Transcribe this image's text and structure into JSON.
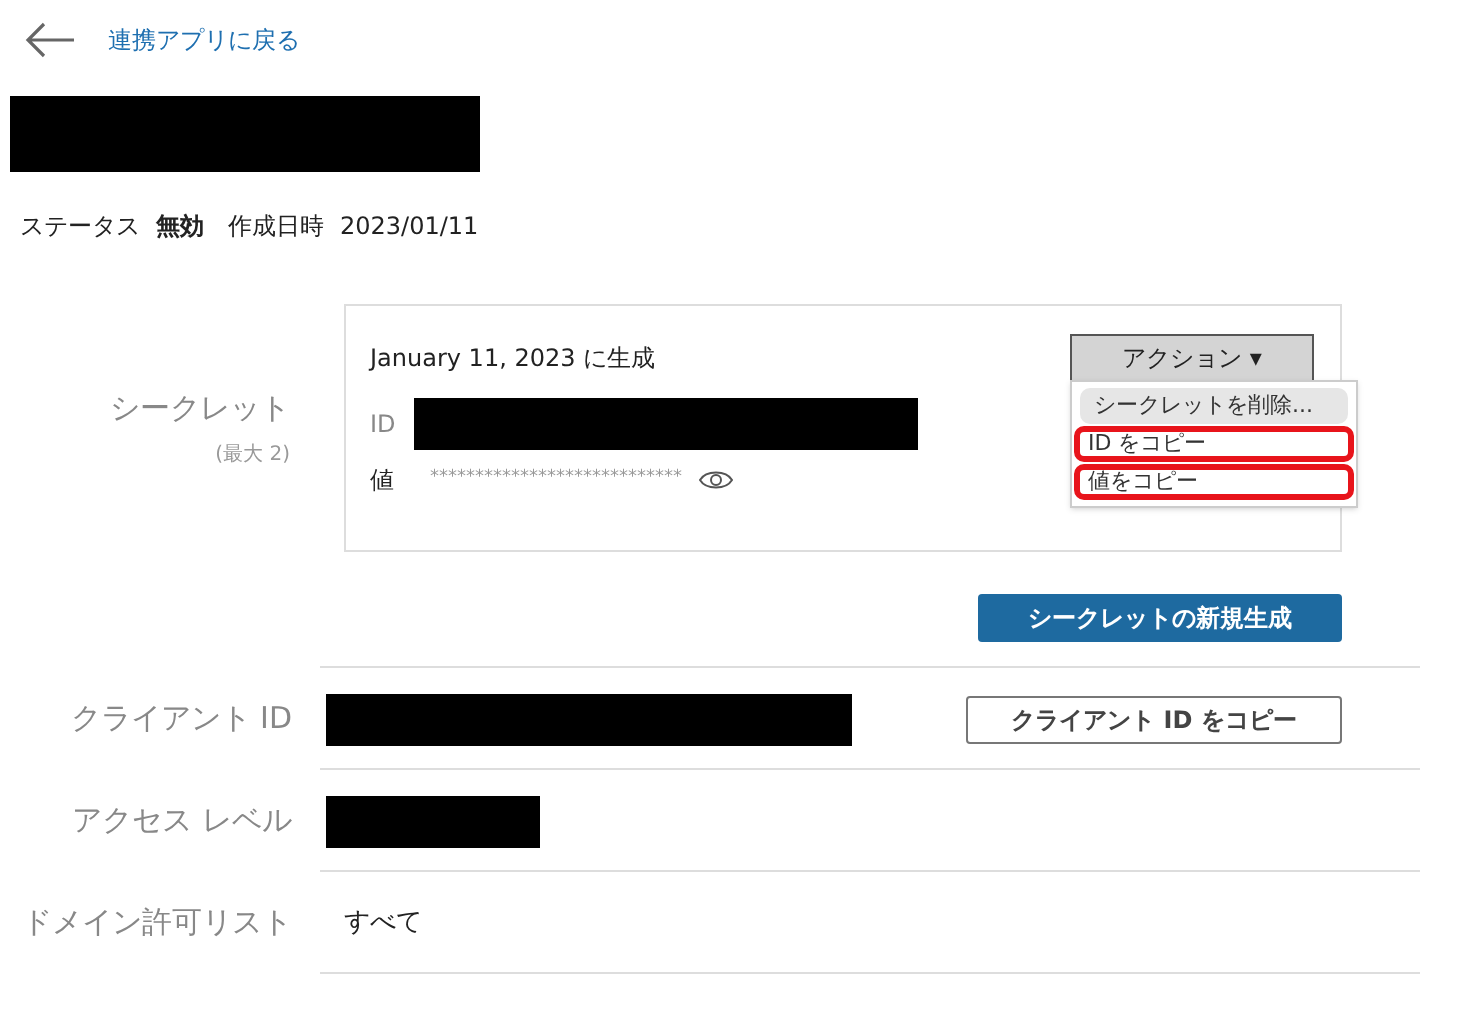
{
  "back_link": "連携アプリに戻る",
  "title": {
    "redacted": true
  },
  "status": {
    "label": "ステータス",
    "value": "無効",
    "created_label": "作成日時",
    "created_value": "2023/01/11"
  },
  "secret": {
    "label": "シークレット",
    "sublabel": "(最大 2)",
    "generated": "January 11, 2023 に生成",
    "action_button": "アクション ▾",
    "id_label": "ID",
    "id_redacted": true,
    "value_label": "値",
    "value_masked": "****************************",
    "menu": [
      {
        "label": "シークレットを削除...",
        "selected": true,
        "circled": false
      },
      {
        "label": "ID をコピー",
        "selected": false,
        "circled": true
      },
      {
        "label": "値をコピー",
        "selected": false,
        "circled": true
      }
    ],
    "new_button": "シークレットの新規生成"
  },
  "rows": [
    {
      "label": "クライアント ID",
      "kind": "redacted",
      "button": "クライアント ID をコピー"
    },
    {
      "label": "アクセス レベル",
      "kind": "redacted"
    },
    {
      "label": "ドメイン許可リスト",
      "kind": "text",
      "value": "すべて"
    }
  ]
}
